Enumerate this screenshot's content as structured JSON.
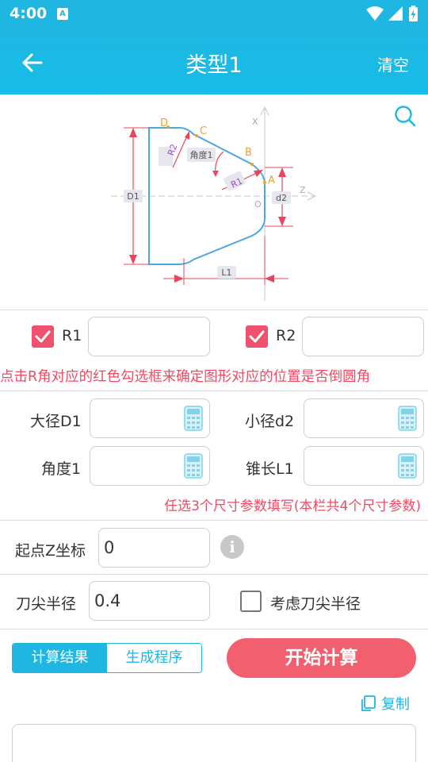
{
  "status_bar": {
    "time": "4:00",
    "notification_icon": "A"
  },
  "app_bar": {
    "title": "类型1",
    "clear_label": "清空"
  },
  "diagram": {
    "labels": {
      "D": "D",
      "C": "C",
      "B": "B",
      "A": "A",
      "O": "O",
      "X": "X",
      "Z": "Z",
      "R1": "R1",
      "R2": "R2",
      "angle": "角度1",
      "D1": "D1",
      "d2": "d2",
      "L1": "L1"
    },
    "colors": {
      "outline": "#4aa8e0",
      "dimension": "#e8455b",
      "point": "#f0a030",
      "axis": "#bbbbbb"
    }
  },
  "radius_row": {
    "r1": {
      "label": "R1",
      "checked": true,
      "value": ""
    },
    "r2": {
      "label": "R2",
      "checked": true,
      "value": ""
    }
  },
  "hint_radius": "点击R角对应的红色勾选框来确定图形对应的位置是否倒圆角",
  "dims": {
    "major_diameter": {
      "label": "大径D1",
      "value": ""
    },
    "minor_diameter": {
      "label": "小径d2",
      "value": ""
    },
    "angle": {
      "label": "角度1",
      "value": ""
    },
    "taper_length": {
      "label": "锥长L1",
      "value": ""
    }
  },
  "hint_dims": "任选3个尺寸参数填写(本栏共4个尺寸参数)",
  "start_z": {
    "label": "起点Z坐标",
    "value": "0"
  },
  "tool_nose": {
    "label": "刀尖半径",
    "value": "0.4",
    "consider_label": "考虑刀尖半径",
    "consider_checked": false
  },
  "tabs": {
    "result": "计算结果",
    "program": "生成程序"
  },
  "start_button": "开始计算",
  "copy_label": "复制",
  "result_text": ""
}
